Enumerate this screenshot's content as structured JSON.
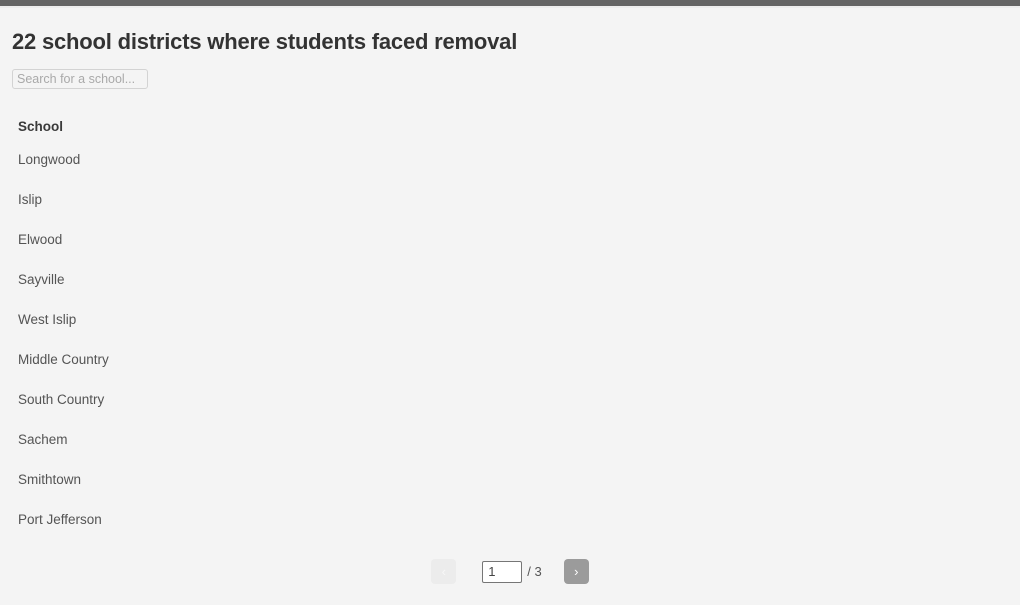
{
  "window": {
    "chrome_color": "#646464",
    "background_color": "#f4f4f4"
  },
  "header": {
    "title": "22 school districts where students faced removal"
  },
  "search": {
    "placeholder": "Search for a school...",
    "value": ""
  },
  "table": {
    "columns": [
      "School"
    ],
    "rows": [
      [
        "Longwood"
      ],
      [
        "Islip"
      ],
      [
        "Elwood"
      ],
      [
        "Sayville"
      ],
      [
        "West Islip"
      ],
      [
        "Middle Country"
      ],
      [
        "South Country"
      ],
      [
        "Sachem"
      ],
      [
        "Smithtown"
      ],
      [
        "Port Jefferson"
      ]
    ]
  },
  "pagination": {
    "prev_label": "‹",
    "next_label": "›",
    "current_page": "1",
    "total_label": "/ 3",
    "total_pages": 3,
    "prev_disabled": true,
    "next_color": "#9b9b9b",
    "prev_color": "#ececec"
  }
}
